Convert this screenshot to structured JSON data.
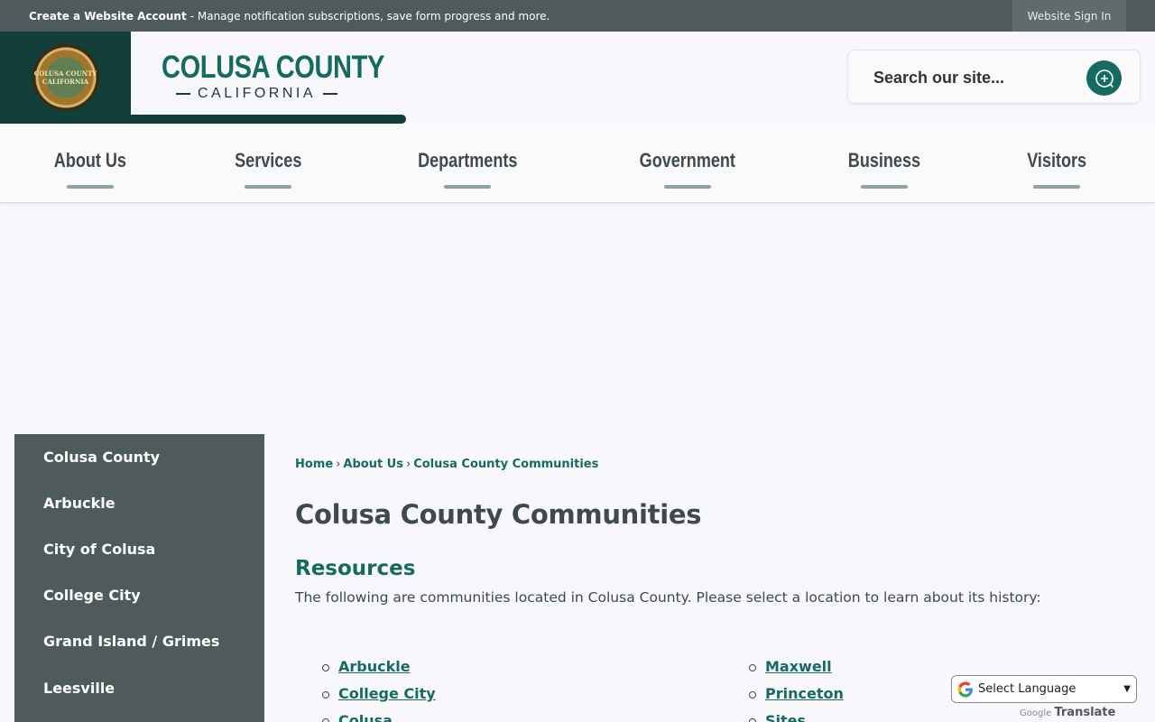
{
  "topbar": {
    "account_link": "Create a Website Account",
    "account_desc": "- Manage notification subscriptions, save form progress and more.",
    "sign_in": "Website Sign In"
  },
  "header": {
    "title": "COLUSA COUNTY",
    "subtitle": "CALIFORNIA",
    "seal_text": "COLUSA COUNTY CALIFORNIA"
  },
  "search": {
    "placeholder": "Search our site..."
  },
  "nav": {
    "items": [
      "About Us",
      "Services",
      "Departments",
      "Government",
      "Business",
      "Visitors"
    ]
  },
  "sidebar": {
    "items": [
      "Colusa County",
      "Arbuckle",
      "City of Colusa",
      "College City",
      "Grand Island / Grimes",
      "Leesville"
    ]
  },
  "content": {
    "breadcrumbs": [
      "Home",
      "About Us",
      "Colusa County Communities"
    ],
    "crumb_sep": "›",
    "page_title": "Colusa County Communities",
    "section_title": "Resources",
    "intro": "The following are communities located in Colusa County. Please select a location to learn about its history:",
    "list_left": [
      "Arbuckle",
      "College City",
      "Colusa"
    ],
    "list_right": [
      "Maxwell",
      "Princeton",
      "Sites"
    ]
  },
  "translate": {
    "select_label": "Select Language",
    "powered_by": "Powered by",
    "google": "Google",
    "translate": "Translate"
  },
  "colors": {
    "brand_green": "#156b5f",
    "dark_green": "#133f3a",
    "slate": "#4f5a5a"
  }
}
